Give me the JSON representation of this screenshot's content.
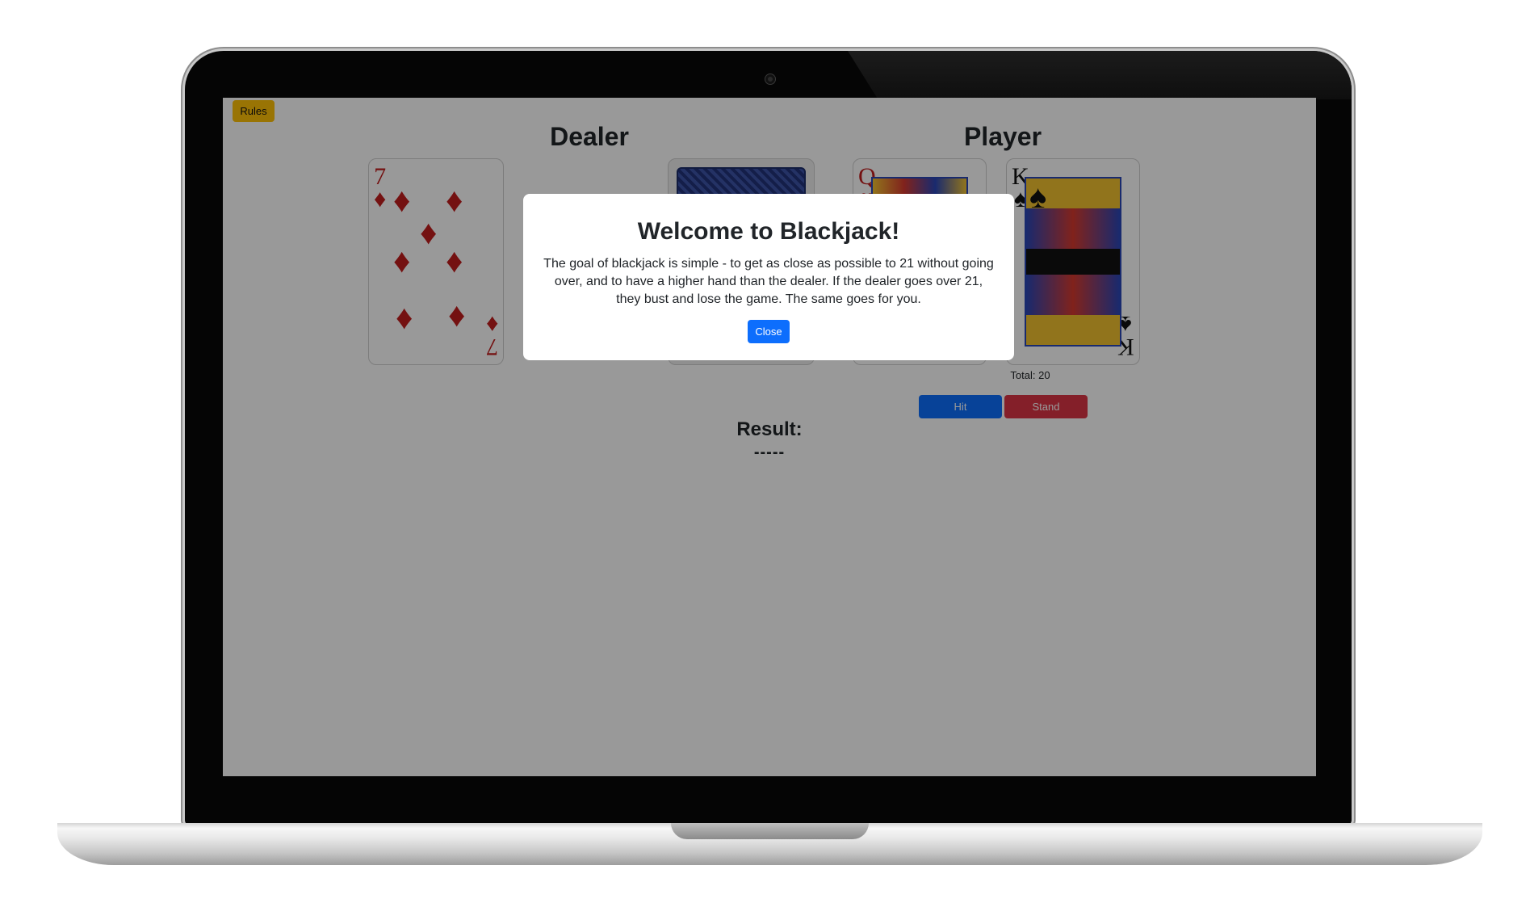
{
  "app": {
    "rules_label": "Rules",
    "dealer_title": "Dealer",
    "player_title": "Player",
    "player_total": "Total: 20",
    "hit_label": "Hit",
    "stand_label": "Stand",
    "result_label": "Result:",
    "result_value": "-----"
  },
  "dealer_cards": [
    {
      "rank": "7",
      "suit": "♦",
      "color": "#c11d1d",
      "face_down": false
    },
    {
      "face_down": true
    }
  ],
  "player_cards": [
    {
      "rank": "Q",
      "suit": "♥",
      "color": "#c11d1d"
    },
    {
      "rank": "K",
      "suit": "♠",
      "color": "#111111"
    }
  ],
  "modal": {
    "title": "Welcome to Blackjack!",
    "body": "The goal of blackjack is simple - to get as close as possible to 21 without going over, and to have a higher hand than the dealer. If the dealer goes over 21, they bust and lose the game. The same goes for you.",
    "close_label": "Close"
  },
  "colors": {
    "primary": "#0d6efd",
    "danger": "#dc3545",
    "warning": "#ffc107"
  }
}
